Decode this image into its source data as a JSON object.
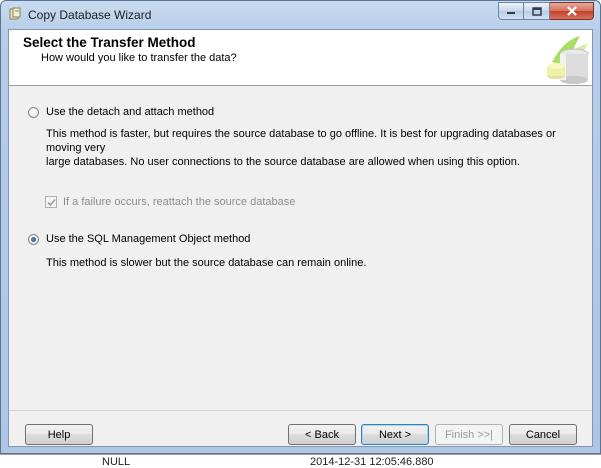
{
  "window": {
    "title": "Copy Database Wizard"
  },
  "header": {
    "title": "Select the Transfer Method",
    "subtitle": "How would you like to transfer the data?"
  },
  "options": {
    "detach": {
      "label": "Use the detach and attach method",
      "selected": false,
      "description_line1": "This method is faster, but requires the source database to go offline. It is best for upgrading databases or moving very",
      "description_line2": "large databases. No user connections to the source database are allowed when using this option."
    },
    "reattach": {
      "label": "If a failure occurs, reattach the source database",
      "checked": true,
      "enabled": false
    },
    "smo": {
      "label": "Use the SQL Management Object method",
      "selected": true,
      "description": "This method is slower but the source database can remain online."
    }
  },
  "buttons": {
    "help": "Help",
    "back": "< Back",
    "next": "Next >",
    "finish": "Finish >>|",
    "cancel": "Cancel"
  },
  "background_grid": {
    "cell1": "NULL",
    "cell2": "2014-12-31 12:05:46.880"
  },
  "colors": {
    "title_bar": "#b7cde8",
    "close_button": "#c44128",
    "panel": "#f0f0f0",
    "default_button_border": "#3c7fb1"
  }
}
